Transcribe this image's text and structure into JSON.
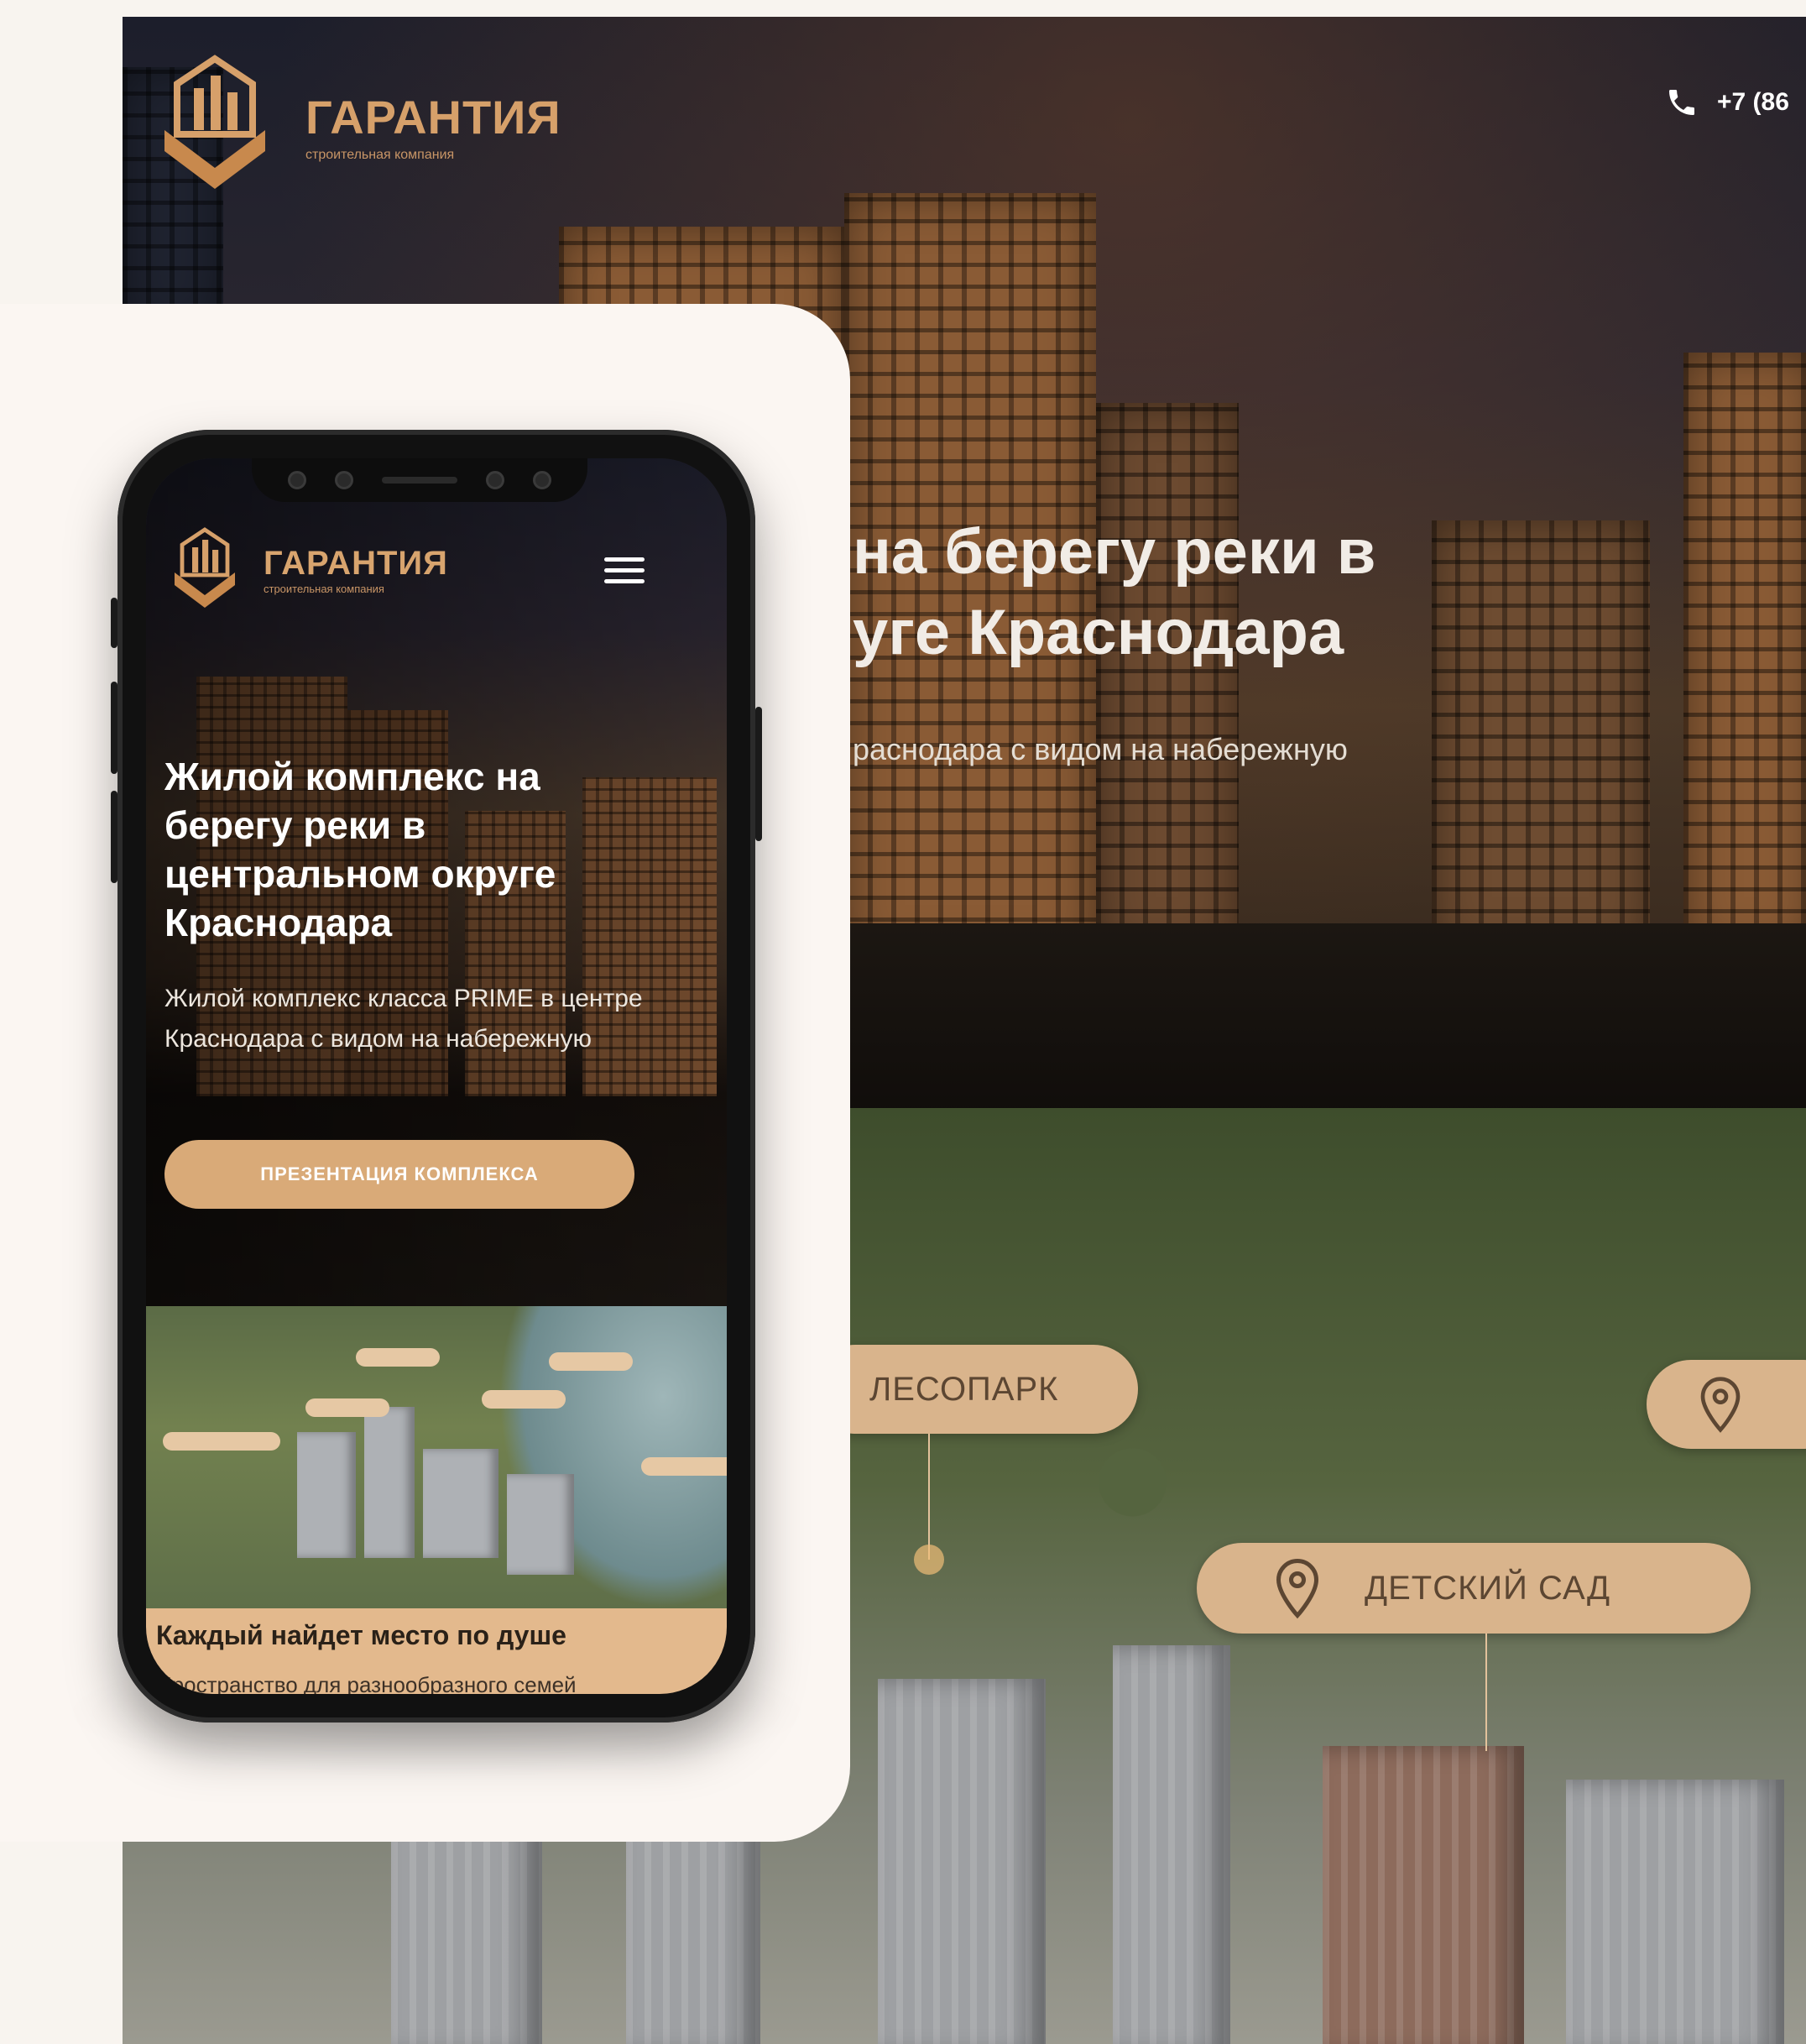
{
  "desktop": {
    "brand": "ГАРАНТИЯ",
    "brand_sub": "строительная компания",
    "phone": "+7 (86",
    "hero_title_line1": "на берегу реки в",
    "hero_title_line2": "уге Краснодара",
    "hero_sub": "раснодара с видом на набережную",
    "map_labels": [
      "ЛЕСОПАРК",
      "ДЕТСКИЙ САД"
    ]
  },
  "mobile": {
    "brand": "ГАРАНТИЯ",
    "brand_sub": "строительная компания",
    "hero_title": "Жилой комплекс на берегу реки в центральном округе Краснодара",
    "hero_desc": "Жилой комплекс класса PRIME в центре Краснодара с видом на набережную",
    "cta_label": "ПРЕЗЕНТАЦИЯ КОМПЛЕКСА",
    "section_title": "Каждый найдет место по душе",
    "section_text": "Пространство для разнообразного семей"
  },
  "icons": [
    "logo-icon",
    "phone-icon",
    "menu-icon",
    "location-pin-icon"
  ],
  "colors": {
    "accent": "#d9aa78",
    "pill": "#d9b48c",
    "brand_text": "#d8a46e",
    "page_bg": "#f8f4ef"
  }
}
